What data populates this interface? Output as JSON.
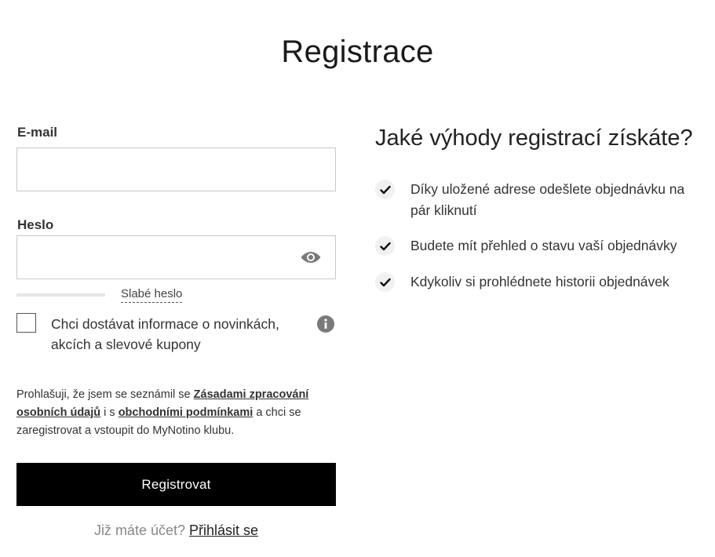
{
  "page": {
    "title": "Registrace"
  },
  "form": {
    "email_label": "E-mail",
    "email_value": "",
    "password_label": "Heslo",
    "password_value": "",
    "password_strength": {
      "label": "Slabé heslo",
      "level": 0
    },
    "newsletter": {
      "checked": false,
      "label": "Chci dostávat informace o novinkách, akcích a slevové kupony"
    },
    "consent": {
      "part1": "Prohlašuji, že jsem se seznámil se ",
      "privacy_link": "Zásadami zpracování osobních údajů",
      "part2": " i s ",
      "terms_link": "obchodními podmínkami",
      "part3": " a chci se zaregistrovat a vstoupit do MyNotino klubu."
    },
    "submit_label": "Registrovat",
    "login_prompt": "Již máte účet?",
    "login_link": "Přihlásit se"
  },
  "benefits": {
    "title": "Jaké výhody registrací získáte?",
    "items": [
      {
        "text": "Díky uložené adrese odešlete objednávku na pár kliknutí"
      },
      {
        "text": "Budete mít přehled o stavu vaší objednávky"
      },
      {
        "text": "Kdykoliv si prohlédnete historii objednávek"
      }
    ]
  },
  "icons": {
    "password_toggle": "eye-icon",
    "newsletter_info": "info-icon",
    "benefit_marker": "checkmark-icon"
  },
  "colors": {
    "button_bg": "#000000",
    "icon_gray": "#7a7a7a",
    "check_circle_bg": "#f1f1f1"
  }
}
